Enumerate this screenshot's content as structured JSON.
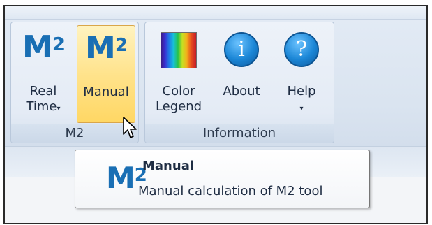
{
  "ribbon": {
    "groups": [
      {
        "label": "M2",
        "buttons": [
          {
            "icon": "m2-icon",
            "icon_text": "M",
            "icon_sup": "2",
            "line1": "Real",
            "line2": "Time",
            "has_dropdown": true
          },
          {
            "icon": "m2-icon",
            "icon_text": "M",
            "icon_sup": "2",
            "line1": "Manual",
            "line2": "",
            "active": true
          }
        ]
      },
      {
        "label": "Information",
        "buttons": [
          {
            "icon": "color-legend-icon",
            "line1": "Color",
            "line2": "Legend"
          },
          {
            "icon": "info-icon",
            "icon_text": "i",
            "line1": "About",
            "line2": ""
          },
          {
            "icon": "help-icon",
            "icon_text": "?",
            "line1": "Help",
            "line2": "",
            "has_dropdown": true
          }
        ]
      }
    ]
  },
  "tooltip": {
    "icon_text": "M",
    "icon_sup": "2",
    "title": "Manual",
    "description": "Manual calculation of M2 tool"
  },
  "colors": {
    "accent": "#1a6fb4",
    "active_button": "#ffd764",
    "ribbon_background": "#dae4f0"
  }
}
